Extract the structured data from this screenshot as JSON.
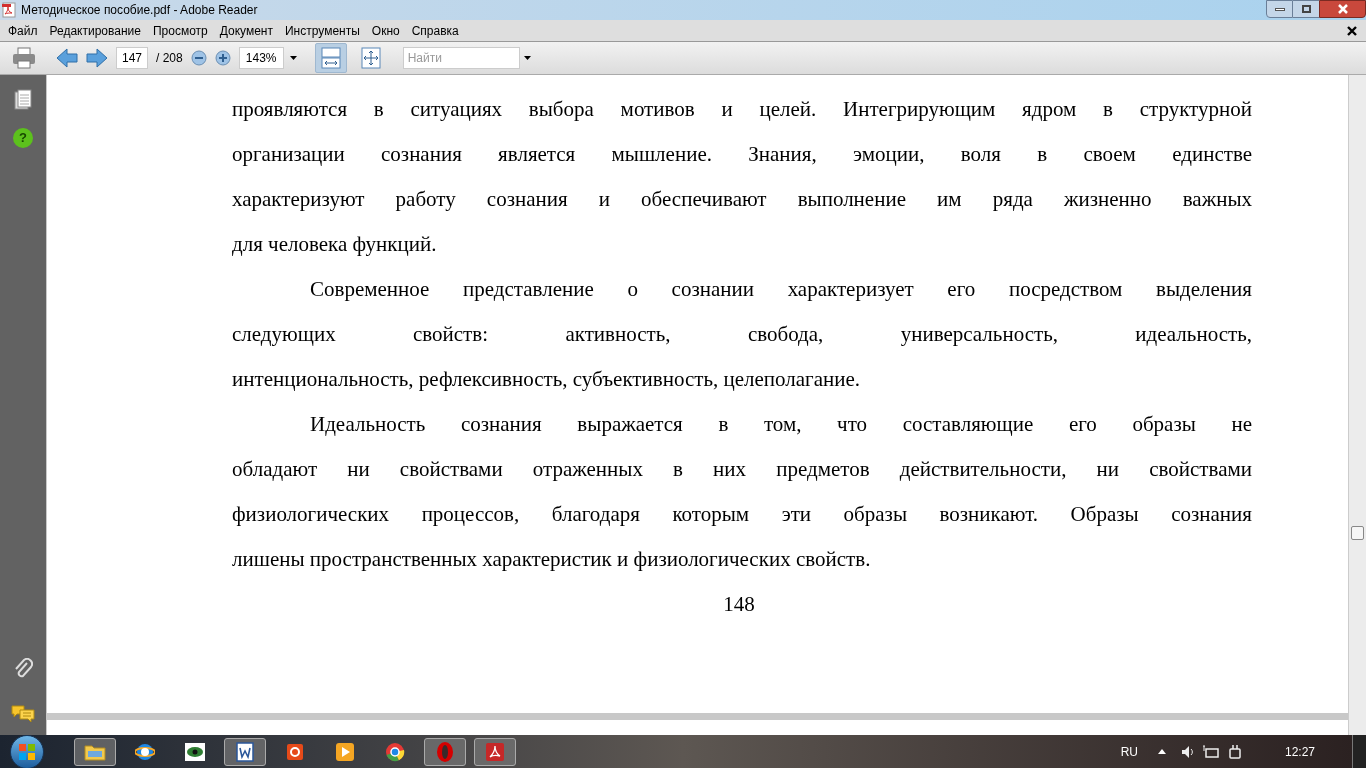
{
  "window": {
    "title": "Методическое пособие.pdf - Adobe Reader"
  },
  "menu": [
    "Файл",
    "Редактирование",
    "Просмотр",
    "Документ",
    "Инструменты",
    "Окно",
    "Справка"
  ],
  "toolbar": {
    "page": "147",
    "page_total": "/ 208",
    "zoom": "143%",
    "search_placeholder": "Найти",
    "fit_width_selected": true
  },
  "sidebar": {
    "help_glyph": "?"
  },
  "document": {
    "paragraphs": [
      {
        "continued": true,
        "lines": [
          "проявляются в ситуациях выбора мотивов и целей. Интегрирующим ядром в структурной",
          "организации сознания является мышление. Знания, эмоции, воля в своем единстве",
          "характеризуют работу сознания и обеспечивают выполнение им ряда жизненно важных",
          "для человека функций."
        ]
      },
      {
        "continued": false,
        "lines": [
          "Современное представление о сознании характеризует его посредством выделения",
          "следующих свойств: активность, свобода, универсальность, идеальность,",
          "интенциональность, рефлексивность, субъективность, целеполагание."
        ]
      },
      {
        "continued": false,
        "lines": [
          "Идеальность сознания выражается в том, что составляющие его образы не",
          "обладают ни свойствами отраженных в них предметов действительности, ни свойствами",
          "физиологических процессов, благодаря которым эти образы возникают. Образы сознания",
          "лишены пространственных характеристик и физиологических свойств."
        ]
      }
    ],
    "page_number": "148"
  },
  "taskbar": {
    "language": "RU",
    "time": "12:27",
    "apps": [
      {
        "kind": "folder",
        "active": true
      },
      {
        "kind": "browser-e",
        "active": false
      },
      {
        "kind": "eye",
        "active": false
      },
      {
        "kind": "word",
        "active": true
      },
      {
        "kind": "slides",
        "active": false
      },
      {
        "kind": "player",
        "active": false
      },
      {
        "kind": "chrome",
        "active": false
      },
      {
        "kind": "opera",
        "active": true
      },
      {
        "kind": "pdf",
        "active": true
      }
    ]
  }
}
